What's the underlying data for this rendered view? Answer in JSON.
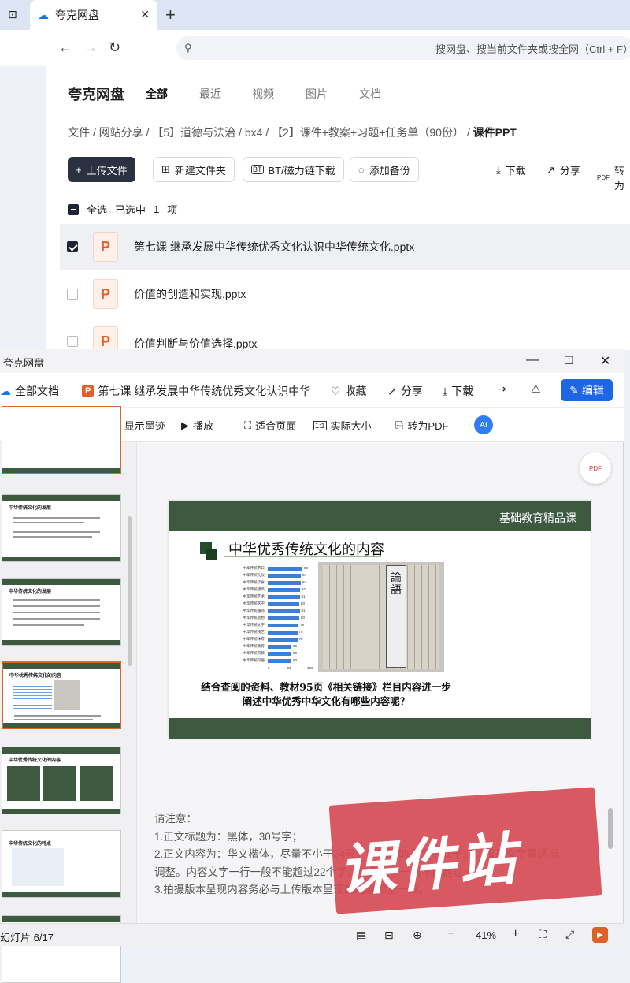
{
  "browser": {
    "tab_title": "夸克网盘",
    "search_placeholder": "搜网盘、搜当前文件夹或搜全网（Ctrl + F）"
  },
  "app": {
    "brand": "夸克网盘",
    "nav": [
      "全部",
      "最近",
      "视频",
      "图片",
      "文档"
    ]
  },
  "breadcrumb": [
    "文件",
    "网站分享",
    "【5】道德与法治",
    "bx4",
    "【2】课件+教案+习题+任务单（90份）",
    "课件PPT"
  ],
  "actions": {
    "upload": "上传文件",
    "new_folder": "新建文件夹",
    "bt": "BT/磁力链下载",
    "backup": "添加备份",
    "download": "下载",
    "share": "分享",
    "convert": "转为"
  },
  "selection": {
    "select_all": "全选",
    "selected": "已选中",
    "count": "1",
    "unit": "项"
  },
  "files": [
    {
      "name": "第七课 继承发展中华传统优秀文化认识中华传统文化.pptx",
      "selected": true
    },
    {
      "name": "价值的创造和实现.pptx",
      "selected": false
    },
    {
      "name": "价值判断与价值选择.pptx",
      "selected": false
    }
  ],
  "viewer": {
    "title": "夸克网盘",
    "all_docs": "全部文档",
    "doc_name": "第七课 继承发展中华传统优秀文化认识中华",
    "fav": "收藏",
    "share": "分享",
    "download": "下载",
    "edit": "编辑",
    "toolbar": [
      "显示墨迹",
      "播放",
      "适合页面",
      "实际大小",
      "转为PDF"
    ]
  },
  "slide": {
    "header": "基础教育精品课",
    "title": "中华优秀传统文化的内容",
    "question": "结合查阅的资料、教材95页《相关链接》栏目内容进一步阐述中华优秀中华文化有哪些内容呢？"
  },
  "chart_data": {
    "type": "bar",
    "categories": [
      "中华传统节日",
      "中华传统礼仪",
      "中华传统饮食",
      "中华传统建筑",
      "中华传统艺术",
      "中华传统医学",
      "中华传统服饰",
      "中华传统思想",
      "中华传统文学",
      "中华传统技艺",
      "中华传统体育",
      "中华传统教育",
      "中华传统宗教",
      "中华传统习俗"
    ],
    "values": [
      88,
      84,
      84,
      82,
      81,
      80,
      81,
      80,
      78,
      75,
      75,
      60,
      60,
      60
    ],
    "xlim": [
      0,
      100
    ]
  },
  "thumb_texts": [
    "中华传统文化的发展",
    "中华传统文化的发展",
    "中华优秀传统文化的内容",
    "中华优秀传统文化的内容",
    "中华传统文化的特点"
  ],
  "notes": [
    "请注意：",
    "1.正文标题为：黑体，30号字；",
    "2.正文内容为：华文楷体，尽量不小于24号，特殊辅助文字不低于18，根据文字量适当",
    "调整。内容文字一行一般不能超过22个字，单元文字一般不能超过8行。",
    "3.拍摄版本呈现内容务必与上传版本呈现的内容完全一致。"
  ],
  "status": {
    "slide_counter": "幻灯片 6/17",
    "zoom": "41%"
  },
  "watermark": "课件站"
}
